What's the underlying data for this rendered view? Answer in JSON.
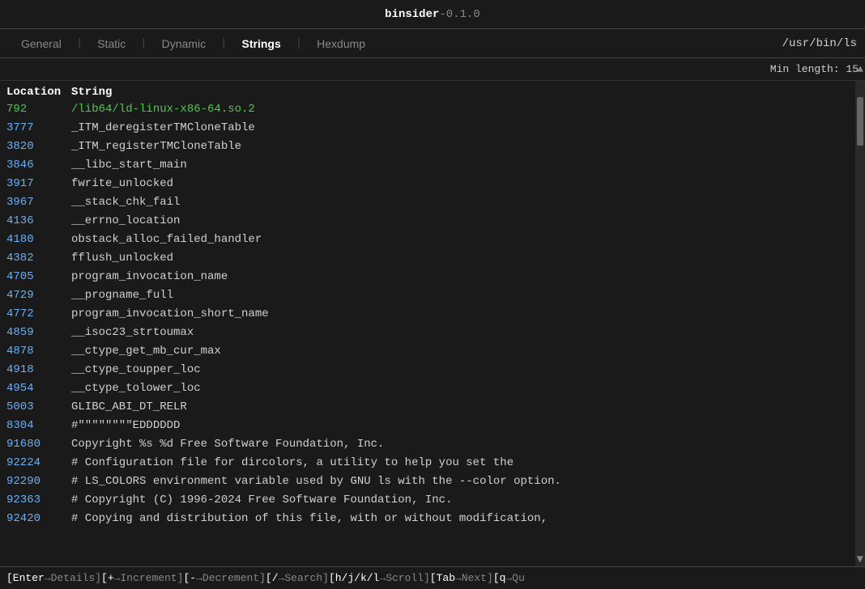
{
  "titlebar": {
    "app_name": "binsider",
    "version": "-0.1.0",
    "file_path": "/usr/bin/ls"
  },
  "tabs": [
    {
      "id": "general",
      "label": "General",
      "active": false
    },
    {
      "id": "static",
      "label": "Static",
      "active": false
    },
    {
      "id": "dynamic",
      "label": "Dynamic",
      "active": false
    },
    {
      "id": "strings",
      "label": "Strings",
      "active": true
    },
    {
      "id": "hexdump",
      "label": "Hexdump",
      "active": false
    }
  ],
  "min_length_bar": {
    "label": "Min length: 15",
    "scroll_up_icon": "▲"
  },
  "header": {
    "col_location": "Location",
    "col_string": "String"
  },
  "rows": [
    {
      "location": "792",
      "string": "/lib64/ld-linux-x86-64.so.2",
      "highlighted": true
    },
    {
      "location": "3777",
      "string": "_ITM_deregisterTMCloneTable",
      "highlighted": false
    },
    {
      "location": "3820",
      "string": "_ITM_registerTMCloneTable",
      "highlighted": false
    },
    {
      "location": "3846",
      "string": "__libc_start_main",
      "highlighted": false
    },
    {
      "location": "3917",
      "string": "fwrite_unlocked",
      "highlighted": false
    },
    {
      "location": "3967",
      "string": "__stack_chk_fail",
      "highlighted": false
    },
    {
      "location": "4136",
      "string": "__errno_location",
      "highlighted": false
    },
    {
      "location": "4180",
      "string": "obstack_alloc_failed_handler",
      "highlighted": false
    },
    {
      "location": "4382",
      "string": "fflush_unlocked",
      "highlighted": false
    },
    {
      "location": "4705",
      "string": "program_invocation_name",
      "highlighted": false
    },
    {
      "location": "4729",
      "string": "__progname_full",
      "highlighted": false
    },
    {
      "location": "4772",
      "string": "program_invocation_short_name",
      "highlighted": false
    },
    {
      "location": "4859",
      "string": "__isoc23_strtoumax",
      "highlighted": false
    },
    {
      "location": "4878",
      "string": "__ctype_get_mb_cur_max",
      "highlighted": false
    },
    {
      "location": "4918",
      "string": "__ctype_toupper_loc",
      "highlighted": false
    },
    {
      "location": "4954",
      "string": "__ctype_tolower_loc",
      "highlighted": false
    },
    {
      "location": "5003",
      "string": "GLIBC_ABI_DT_RELR",
      "highlighted": false
    },
    {
      "location": "8304",
      "string": "#\"\"\"\"\"\"\"\"EDDDDDD",
      "highlighted": false
    },
    {
      "location": "91680",
      "string": "Copyright %s %d Free Software Foundation, Inc.",
      "highlighted": false
    },
    {
      "location": "92224",
      "string": "# Configuration file for dircolors, a utility to help you set the",
      "highlighted": false
    },
    {
      "location": "92290",
      "string": "# LS_COLORS environment variable used by GNU ls with the --color option.",
      "highlighted": false
    },
    {
      "location": "92363",
      "string": "# Copyright (C) 1996-2024 Free Software Foundation, Inc.",
      "highlighted": false
    },
    {
      "location": "92420",
      "string": "# Copying and distribution of this file, with or without modification,",
      "highlighted": false
    }
  ],
  "scrollbar": {
    "down_icon": "▼"
  },
  "status_bar": {
    "items": [
      {
        "key": "[Enter",
        "arrow": "→",
        "label": "Details]"
      },
      {
        "key": " [+",
        "arrow": "→",
        "label": "Increment]"
      },
      {
        "key": " [-",
        "arrow": "→",
        "label": "Decrement]"
      },
      {
        "key": " [/",
        "arrow": "→",
        "label": "Search]"
      },
      {
        "key": " [h/j/k/l",
        "arrow": "→",
        "label": "Scroll]"
      },
      {
        "key": " [Tab",
        "arrow": "→",
        "label": "Next]"
      },
      {
        "key": " [q",
        "arrow": "→",
        "label": "Qu"
      }
    ]
  }
}
